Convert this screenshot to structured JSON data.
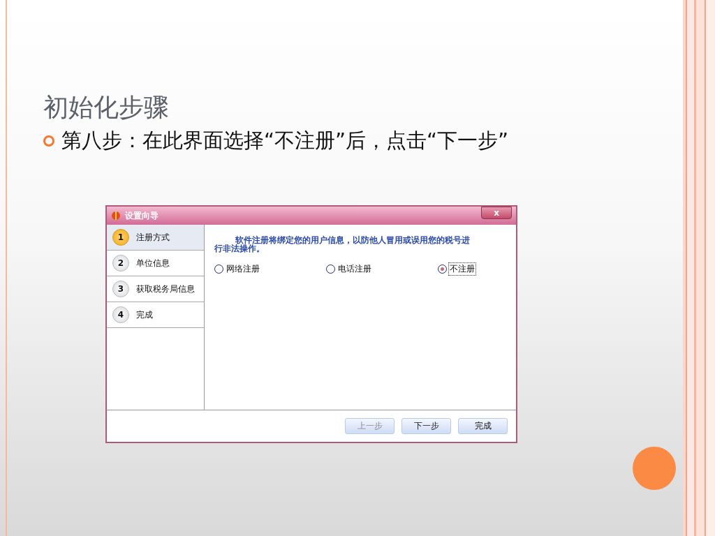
{
  "slide": {
    "title": "初始化步骤",
    "bullet": "第八步：在此界面选择“不注册”后，点击“下一步”"
  },
  "dialog": {
    "title": "设置向导",
    "close": "x",
    "steps": [
      {
        "number": "1",
        "label": "注册方式",
        "selected": true
      },
      {
        "number": "2",
        "label": "单位信息",
        "selected": false
      },
      {
        "number": "3",
        "label": "获取税务局信息",
        "selected": false
      },
      {
        "number": "4",
        "label": "完成",
        "selected": false
      }
    ],
    "message": "软件注册将绑定您的用户信息，以防他人冒用或误用您的税号进行非法操作。",
    "options": [
      {
        "label": "网络注册",
        "selected": false
      },
      {
        "label": "电话注册",
        "selected": false
      },
      {
        "label": "不注册",
        "selected": true
      }
    ],
    "buttons": [
      {
        "label": "上一步",
        "disabled": true
      },
      {
        "label": "下一步",
        "disabled": false
      },
      {
        "label": "完成",
        "disabled": false
      }
    ]
  }
}
